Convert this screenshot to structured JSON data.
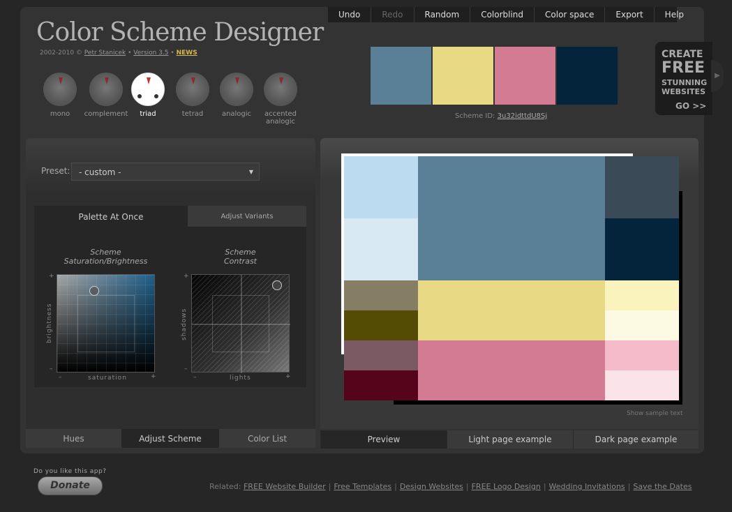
{
  "header": {
    "title": "Color Scheme Designer",
    "credits_prefix": "2002-2010 ©",
    "author": "Petr Stanicek",
    "bullet": "•",
    "version": "Version 3.5",
    "news": "NEWS"
  },
  "menu": [
    {
      "label": "Undo",
      "enabled": true
    },
    {
      "label": "Redo",
      "enabled": false
    },
    {
      "label": "Random",
      "enabled": true
    },
    {
      "label": "Colorblind",
      "enabled": true
    },
    {
      "label": "Color space",
      "enabled": true
    },
    {
      "label": "Export",
      "enabled": true
    },
    {
      "label": "Help",
      "enabled": true
    }
  ],
  "swatches": [
    "#5a8098",
    "#e8d984",
    "#d27b93",
    "#04243b"
  ],
  "scheme_id": {
    "label": "Scheme ID:",
    "value": "3u32idttdU8Sj"
  },
  "ad": {
    "l1": "CREATE",
    "l2": "FREE",
    "l3": "STUNNING",
    "l4": "WEBSITES",
    "l5": "GO >>"
  },
  "schemes": [
    {
      "label": "mono",
      "active": false
    },
    {
      "label": "complement",
      "active": false
    },
    {
      "label": "triad",
      "active": true
    },
    {
      "label": "tetrad",
      "active": false
    },
    {
      "label": "analogic",
      "active": false
    },
    {
      "label": "accented analogic",
      "active": false
    }
  ],
  "preset": {
    "label": "Preset:",
    "value": "- custom -"
  },
  "subtabs": {
    "active": "Palette At Once",
    "inactive": "Adjust Variants"
  },
  "graphs": {
    "g1_title": "Scheme",
    "g1_subtitle": "Saturation/Brightness",
    "g1_xlabel": "saturation",
    "g1_ylabel": "brightness",
    "g2_title": "Scheme",
    "g2_subtitle": "Contrast",
    "g2_xlabel": "lights",
    "g2_ylabel": "shadows",
    "plus": "+",
    "minus": "–"
  },
  "left_tabs": [
    {
      "label": "Hues",
      "active": false
    },
    {
      "label": "Adjust Scheme",
      "active": true
    },
    {
      "label": "Color List",
      "active": false
    }
  ],
  "preview_colors": {
    "main": "#5a8098",
    "light1": "#bcdbf0",
    "light2": "#d9e9f3",
    "dark1": "#3a4a57",
    "dark2": "#04243b",
    "yellow_main": "#e8d984",
    "yellow_d1": "#857e64",
    "yellow_d2": "#544b05",
    "yellow_l1": "#faf3be",
    "yellow_l2": "#fdfae4",
    "pink_main": "#d27b93",
    "pink_d1": "#7b5a64",
    "pink_d2": "#56041b",
    "pink_l1": "#f6bbcb",
    "pink_l2": "#fae4ea"
  },
  "show_sample": "Show sample text",
  "right_tabs": [
    {
      "label": "Preview",
      "active": true
    },
    {
      "label": "Light page example",
      "active": false
    },
    {
      "label": "Dark page example",
      "active": false
    }
  ],
  "footer": {
    "like": "Do you like this app?",
    "donate": "Donate",
    "related_label": "Related:",
    "links": [
      "FREE Website Builder",
      "Free Templates",
      "Design Websites",
      "FREE Logo Design",
      "Wedding Invitations",
      "Save the Dates"
    ],
    "separator": "|"
  }
}
